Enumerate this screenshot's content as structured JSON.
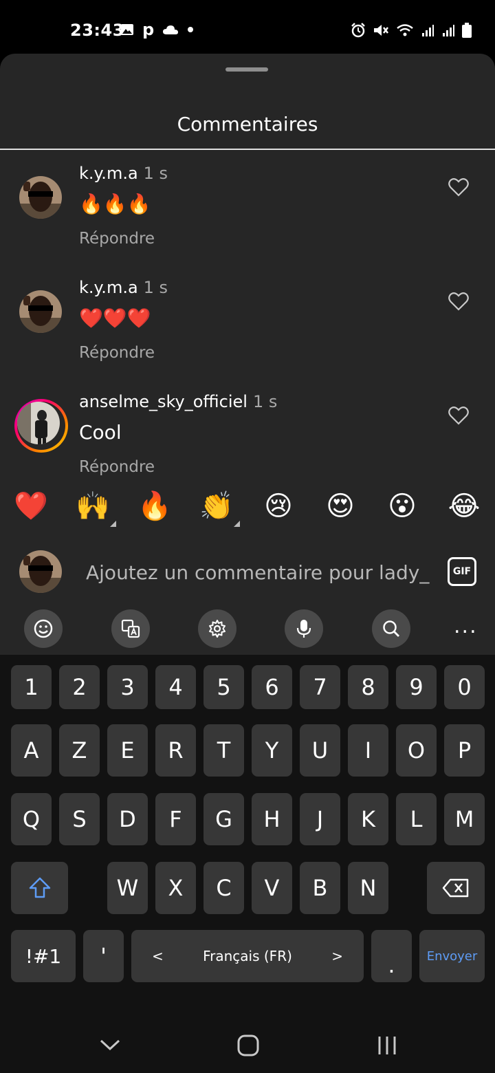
{
  "status_bar": {
    "time": "23:43",
    "left_icons": [
      "gallery-icon",
      "p-icon",
      "cloud-icon",
      "dot-icon"
    ],
    "right_icons": [
      "alarm-icon",
      "mute-icon",
      "wifi-icon",
      "signal-icon",
      "signal-icon",
      "battery-icon"
    ],
    "p_glyph": "p"
  },
  "sheet": {
    "title": "Commentaires"
  },
  "comments": [
    {
      "username": "k.y.m.a",
      "time": "1 s",
      "text": "🔥🔥🔥",
      "reply_label": "Répondre",
      "story_ring": false
    },
    {
      "username": "k.y.m.a",
      "time": "1 s",
      "text": "❤️❤️❤️",
      "reply_label": "Répondre",
      "story_ring": false
    },
    {
      "username": "anselme_sky_officiel",
      "time": "1 s",
      "text": "Cool",
      "reply_label": "Répondre",
      "story_ring": true
    }
  ],
  "reactions": [
    "❤️",
    "🙌",
    "🔥",
    "👏",
    "😢",
    "😍",
    "😮",
    "😂"
  ],
  "composer": {
    "placeholder": "Ajoutez un commentaire pour lady_",
    "gif_label": "GIF"
  },
  "keyboard": {
    "toolbar": [
      "emoji-icon",
      "translate-icon",
      "settings-icon",
      "microphone-icon",
      "search-icon",
      "more-icon"
    ],
    "more_label": "...",
    "rows": [
      [
        "1",
        "2",
        "3",
        "4",
        "5",
        "6",
        "7",
        "8",
        "9",
        "0"
      ],
      [
        "A",
        "Z",
        "E",
        "R",
        "T",
        "Y",
        "U",
        "I",
        "O",
        "P"
      ],
      [
        "Q",
        "S",
        "D",
        "F",
        "G",
        "H",
        "J",
        "K",
        "L",
        "M"
      ],
      [
        "W",
        "X",
        "C",
        "V",
        "B",
        "N"
      ]
    ],
    "symbols_label": "!#1",
    "apostrophe": "'",
    "language": "Français (FR)",
    "lang_prev": "<",
    "lang_next": ">",
    "period": ".",
    "send_label": "Envoyer"
  },
  "colors": {
    "sheet": "#262626",
    "key": "#373737",
    "keyboard": "#121212",
    "accent": "#5e9cf5"
  }
}
